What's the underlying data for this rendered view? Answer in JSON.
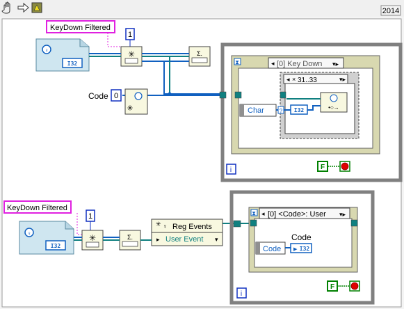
{
  "toolbar": {
    "year": "2014",
    "icons": [
      "hand-icon",
      "arrow-right-icon",
      "tree-icon"
    ]
  },
  "top_diagram": {
    "label": "KeyDown Filtered",
    "constant": "1",
    "code_label": "Code",
    "code_constant": "0",
    "ref_type": "I32",
    "event_case": "[0] Key Down",
    "case_range": "31..33",
    "char_label": "Char",
    "char_type": "I32",
    "stop_value": "F",
    "loop_index": "i"
  },
  "bottom_diagram": {
    "label": "KeyDown Filtered",
    "constant": "1",
    "ref_type": "I32",
    "reg_events": "Reg Events",
    "user_event": "User Event",
    "event_case": "[0] <Code>: User",
    "code_header": "Code",
    "code_label": "Code",
    "code_type": "I32",
    "stop_value": "F",
    "loop_index": "i"
  },
  "colors": {
    "frame": "#808080",
    "wire_blue": "#1060c0",
    "wire_teal": "#108080",
    "label_pink": "#e020e0",
    "bool_green": "#008000",
    "stop_red": "#e00000"
  }
}
